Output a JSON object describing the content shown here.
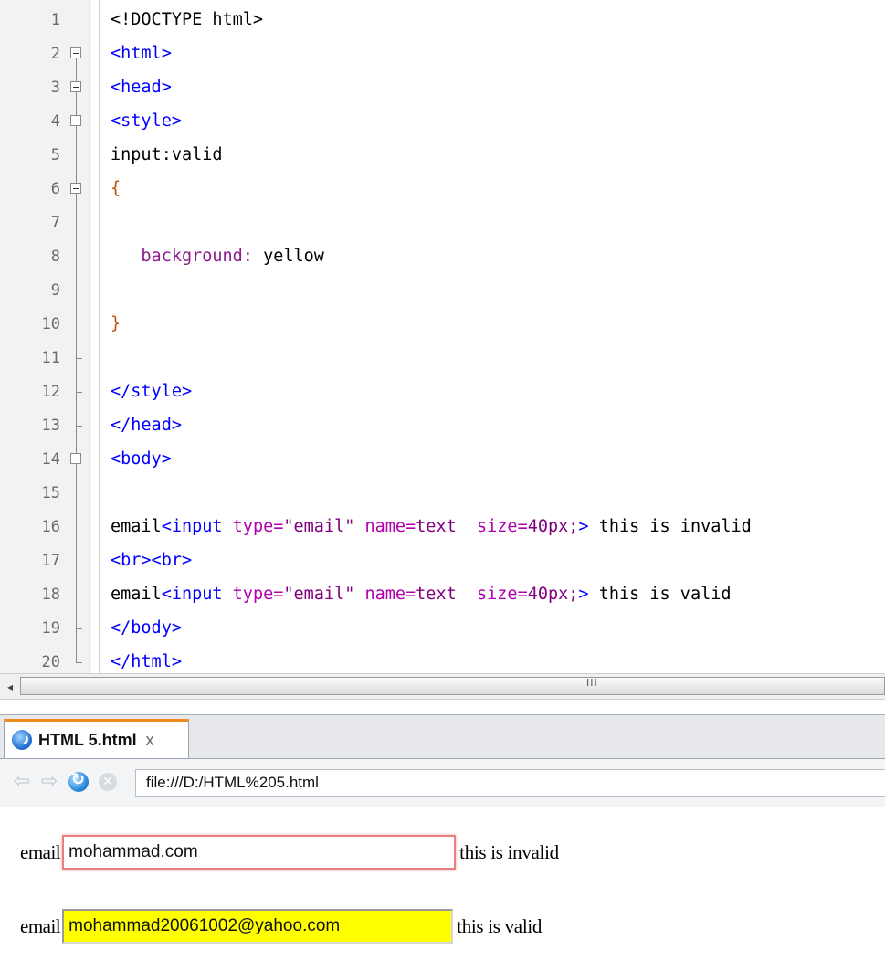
{
  "editor": {
    "lines": [
      {
        "n": "1",
        "fold": "none",
        "tokens": [
          {
            "c": "t-txt",
            "t": "<!DOCTYPE html>"
          }
        ]
      },
      {
        "n": "2",
        "fold": "open",
        "tokens": [
          {
            "c": "t-tag",
            "t": "<html>"
          }
        ]
      },
      {
        "n": "3",
        "fold": "open",
        "tokens": [
          {
            "c": "t-tag",
            "t": "<head>"
          }
        ]
      },
      {
        "n": "4",
        "fold": "open",
        "tokens": [
          {
            "c": "t-tag",
            "t": "<style>"
          }
        ]
      },
      {
        "n": "5",
        "fold": "line",
        "tokens": [
          {
            "c": "t-txt",
            "t": "input:valid"
          }
        ]
      },
      {
        "n": "6",
        "fold": "open",
        "tokens": [
          {
            "c": "t-brace",
            "t": "{"
          }
        ]
      },
      {
        "n": "7",
        "fold": "line",
        "tokens": []
      },
      {
        "n": "8",
        "fold": "line",
        "tokens": [
          {
            "c": "t-txt",
            "t": "   "
          },
          {
            "c": "t-prop",
            "t": "background:"
          },
          {
            "c": "t-txt",
            "t": " yellow"
          }
        ]
      },
      {
        "n": "9",
        "fold": "line",
        "tokens": []
      },
      {
        "n": "10",
        "fold": "line",
        "tokens": [
          {
            "c": "t-brace",
            "t": "}"
          }
        ]
      },
      {
        "n": "11",
        "fold": "end",
        "tokens": []
      },
      {
        "n": "12",
        "fold": "end",
        "tokens": [
          {
            "c": "t-tag",
            "t": "</style>"
          }
        ]
      },
      {
        "n": "13",
        "fold": "end",
        "tokens": [
          {
            "c": "t-tag",
            "t": "</head>"
          }
        ]
      },
      {
        "n": "14",
        "fold": "open",
        "tokens": [
          {
            "c": "t-tag",
            "t": "<body>"
          }
        ]
      },
      {
        "n": "15",
        "fold": "line",
        "tokens": []
      },
      {
        "n": "16",
        "fold": "line",
        "tokens": [
          {
            "c": "t-txt",
            "t": "email"
          },
          {
            "c": "t-tag",
            "t": "<input "
          },
          {
            "c": "t-attr",
            "t": "type="
          },
          {
            "c": "t-str",
            "t": "\"email\""
          },
          {
            "c": "t-attr",
            "t": " name="
          },
          {
            "c": "t-str",
            "t": "text"
          },
          {
            "c": "t-txt",
            "t": "  "
          },
          {
            "c": "t-attr",
            "t": "size="
          },
          {
            "c": "t-str",
            "t": "40px;"
          },
          {
            "c": "t-tag",
            "t": ">"
          },
          {
            "c": "t-txt",
            "t": " this is invalid"
          }
        ]
      },
      {
        "n": "17",
        "fold": "line",
        "tokens": [
          {
            "c": "t-tag",
            "t": "<br><br>"
          }
        ]
      },
      {
        "n": "18",
        "fold": "line",
        "tokens": [
          {
            "c": "t-txt",
            "t": "email"
          },
          {
            "c": "t-tag",
            "t": "<input "
          },
          {
            "c": "t-attr",
            "t": "type="
          },
          {
            "c": "t-str",
            "t": "\"email\""
          },
          {
            "c": "t-attr",
            "t": " name="
          },
          {
            "c": "t-str",
            "t": "text"
          },
          {
            "c": "t-txt",
            "t": "  "
          },
          {
            "c": "t-attr",
            "t": "size="
          },
          {
            "c": "t-str",
            "t": "40px;"
          },
          {
            "c": "t-tag",
            "t": ">"
          },
          {
            "c": "t-txt",
            "t": " this is valid"
          }
        ]
      },
      {
        "n": "19",
        "fold": "end",
        "tokens": [
          {
            "c": "t-tag",
            "t": "</body>"
          }
        ]
      },
      {
        "n": "20",
        "fold": "last",
        "tokens": [
          {
            "c": "t-tag",
            "t": "</html>"
          }
        ]
      }
    ]
  },
  "scrollbar": {
    "left_arrow": "◂",
    "grip": "III"
  },
  "browser": {
    "tab_title": "HTML 5.html",
    "tab_close": "x",
    "tab_accent": "#f08a1c",
    "back_icon": "⇦",
    "forward_icon": "⇨",
    "stop_icon": "✕",
    "address": "file:///D:/HTML%205.html"
  },
  "page": {
    "row1": {
      "label": "email",
      "value": "mohammad.com",
      "after": "this is invalid",
      "border_color": "#e98080"
    },
    "row2": {
      "label": "email",
      "value": "mohammad20061002@yahoo.com",
      "after": "this is valid",
      "fill_color": "#ffff00"
    }
  }
}
